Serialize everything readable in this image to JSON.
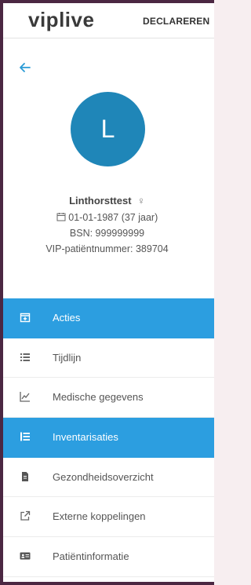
{
  "header": {
    "logo": "viplive",
    "declareren": "DECLAREREN"
  },
  "back_icon": "arrow-left-icon",
  "patient": {
    "initial": "L",
    "name": "Linthorsttest",
    "gender_symbol": "♀",
    "birthdate": "01-01-1987",
    "age": "(37 jaar)",
    "bsn": "BSN: 999999999",
    "vip_number": "VIP-patiëntnummer: 389704"
  },
  "nav": {
    "items": [
      {
        "label": "Acties",
        "icon": "calendar-plus-icon",
        "active": true
      },
      {
        "label": "Tijdlijn",
        "icon": "list-icon",
        "active": false
      },
      {
        "label": "Medische gegevens",
        "icon": "line-chart-icon",
        "active": false
      },
      {
        "label": "Inventarisaties",
        "icon": "list-ol-icon",
        "active": true
      },
      {
        "label": "Gezondheidsoverzicht",
        "icon": "file-icon",
        "active": false
      },
      {
        "label": "Externe koppelingen",
        "icon": "external-link-icon",
        "active": false
      },
      {
        "label": "Patiëntinformatie",
        "icon": "id-card-icon",
        "active": false
      }
    ]
  },
  "colors": {
    "accent": "#2c9ee0",
    "avatar": "#1f86b8",
    "frame": "#4b2742"
  }
}
